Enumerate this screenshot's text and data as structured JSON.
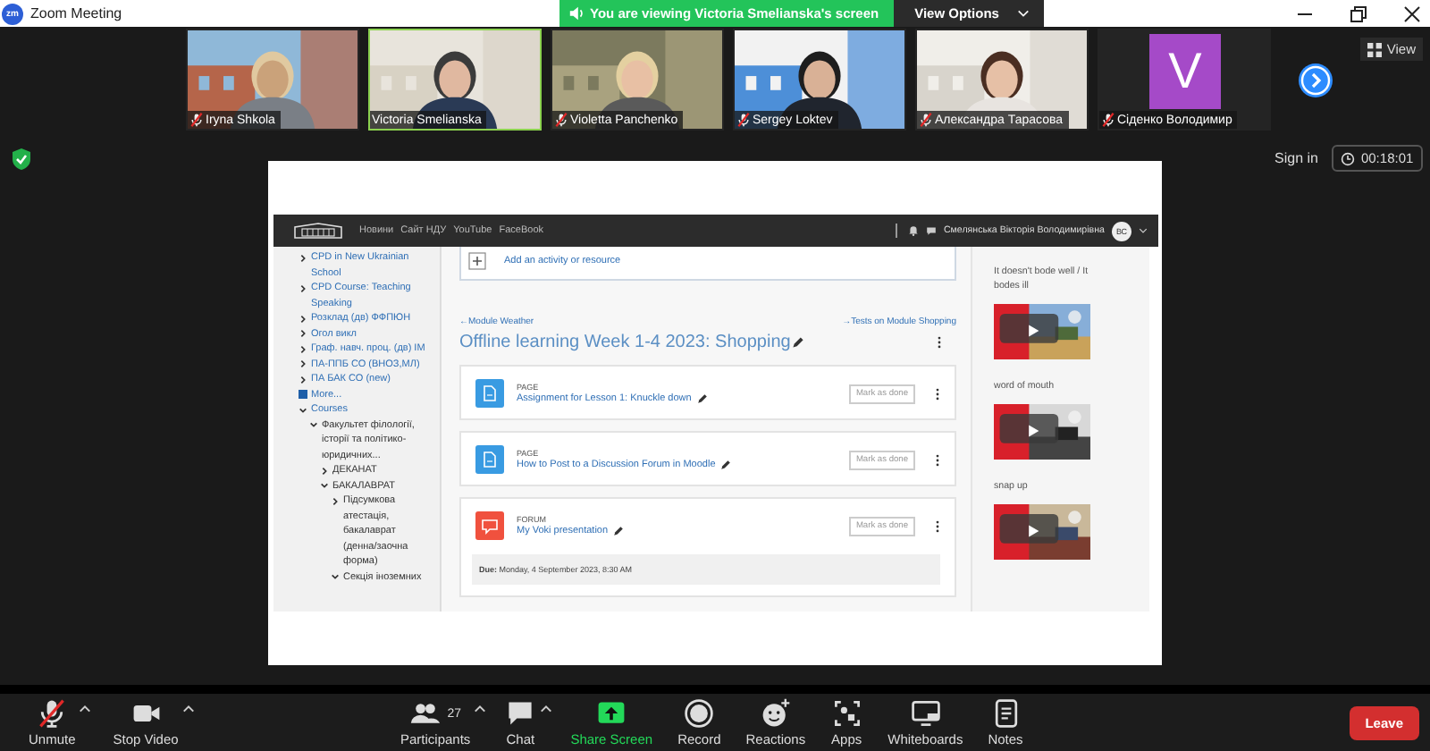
{
  "window": {
    "logo": "zm",
    "title": "Zoom Meeting"
  },
  "banner": {
    "text": "You are viewing Victoria Smelianska's screen",
    "view_options": "View Options"
  },
  "participants": [
    {
      "name": "Iryna Shkola",
      "kind": "video",
      "muted": true,
      "speaking": false
    },
    {
      "name": "Victoria Smelianska",
      "kind": "video",
      "muted": false,
      "speaking": true
    },
    {
      "name": "Violetta Panchenko",
      "kind": "video",
      "muted": true,
      "speaking": false
    },
    {
      "name": "Sergey Loktev",
      "kind": "video",
      "muted": true,
      "speaking": false
    },
    {
      "name": "Александра Тарасова",
      "kind": "video",
      "muted": true,
      "speaking": false
    },
    {
      "name": "Сіденко Володимир",
      "kind": "avatar",
      "initial": "V",
      "muted": true,
      "speaking": false
    }
  ],
  "view_button": "View",
  "sign_in": "Sign in",
  "timer": "00:18:01",
  "shared_screen": {
    "nav": {
      "links": [
        "Новини",
        "Сайт НДУ",
        "YouTube",
        "FaceBook"
      ],
      "user": "Смелянська Вікторія Володимирівна",
      "avatar": "ВС"
    },
    "sidebar": [
      {
        "kind": "node",
        "label": "CPD in New Ukrainian School",
        "expanded": false
      },
      {
        "kind": "node",
        "label": "CPD Course: Teaching Speaking",
        "expanded": false
      },
      {
        "kind": "node",
        "label": "Розклад (дв) ФФПЮН",
        "expanded": false
      },
      {
        "kind": "node",
        "label": "Огол викл",
        "expanded": false
      },
      {
        "kind": "node",
        "label": "Граф. навч. проц. (дв) ІМ",
        "expanded": false
      },
      {
        "kind": "node",
        "label": "ПА-ППБ СО (ВНОЗ,МЛ)",
        "expanded": false
      },
      {
        "kind": "node",
        "label": "ПА БАК СО (new)",
        "expanded": false
      },
      {
        "kind": "more",
        "label": "More..."
      },
      {
        "kind": "node",
        "label": "Courses",
        "expanded": true,
        "children": [
          {
            "kind": "node",
            "label": "Факультет філології, історії та політико-юридичних...",
            "expanded": true,
            "children": [
              {
                "kind": "node",
                "label": "ДЕКАНАТ",
                "expanded": false
              },
              {
                "kind": "node",
                "label": "БАКАЛАВРАТ",
                "expanded": true,
                "children": [
                  {
                    "kind": "node",
                    "label": "Підсумкова атестація, бакалаврат (денна/заочна форма)",
                    "expanded": false
                  },
                  {
                    "kind": "node",
                    "label": "Секція іноземних",
                    "expanded": true
                  }
                ]
              }
            ]
          }
        ]
      }
    ],
    "add_activity": "Add an activity or resource",
    "prev_link": "←Module Weather",
    "next_link": "→Tests on Module Shopping",
    "section_title": "Offline learning Week 1-4 2023: Shopping",
    "activities": [
      {
        "kind": "page",
        "type": "PAGE",
        "title": "Assignment for Lesson 1: Knuckle down",
        "button": "Mark as done"
      },
      {
        "kind": "page",
        "type": "PAGE",
        "title": "How to Post to a Discussion Forum in Moodle",
        "button": "Mark as done"
      },
      {
        "kind": "forum",
        "type": "FORUM",
        "title": "My Voki presentation",
        "button": "Mark as done",
        "due": "**Due:** Monday, 4 September 2023, 8:30 AM"
      }
    ],
    "videos": [
      {
        "title": "It doesn't bode well / It bodes ill"
      },
      {
        "title": "word of mouth"
      },
      {
        "title": "snap up"
      }
    ]
  },
  "toolbar": [
    {
      "kind": "mic",
      "label": "Unmute",
      "muted": true,
      "menu": true
    },
    {
      "kind": "camera",
      "label": "Stop Video",
      "menu": true
    },
    {
      "kind": "participants",
      "label": "Participants",
      "count": "27",
      "menu": true
    },
    {
      "kind": "chat",
      "label": "Chat",
      "menu": true
    },
    {
      "kind": "share",
      "label": "Share Screen",
      "menu": false
    },
    {
      "kind": "record",
      "label": "Record",
      "menu": false
    },
    {
      "kind": "reactions",
      "label": "Reactions",
      "menu": false
    },
    {
      "kind": "apps",
      "label": "Apps",
      "menu": false
    },
    {
      "kind": "whiteboards",
      "label": "Whiteboards",
      "menu": false
    },
    {
      "kind": "notes",
      "label": "Notes",
      "menu": false
    }
  ],
  "leave": "Leave"
}
